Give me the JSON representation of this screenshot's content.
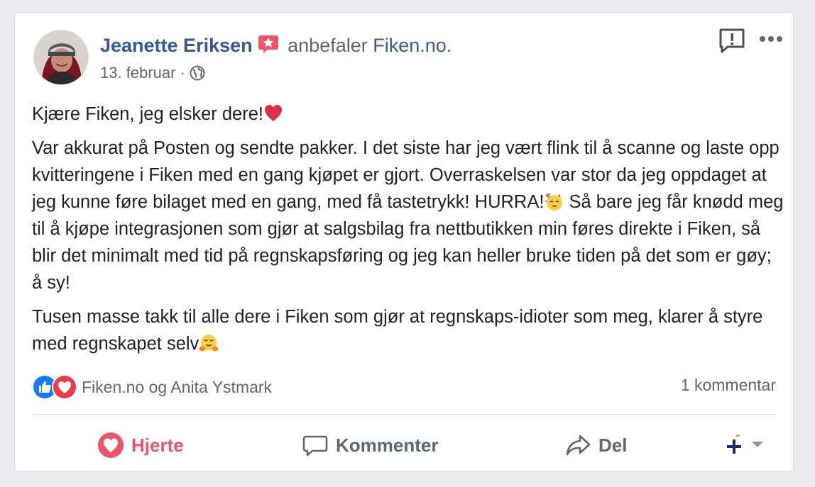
{
  "post": {
    "author": "Jeanette Eriksen",
    "action_text": "anbefaler",
    "page_name": "Fiken.no.",
    "date": "13. februar",
    "separator": "·",
    "paragraphs": [
      {
        "text": "Kjære Fiken, jeg elsker dere!",
        "emoji": "red-heart"
      },
      {
        "text_before_emoji": "Var akkurat på Posten og sendte pakker. I det siste har jeg vært flink til å scanne og laste opp kvitteringene i Fiken med en gang kjøpet er gjort. Overraskelsen var stor da jeg oppdaget at jeg kunne føre bilaget med en gang, med få tastetrykk! HURRA!",
        "emoji": "partying-face",
        "text_after_emoji": " Så bare jeg får knødd meg til å kjøpe integrasjonen som gjør at salgsbilag fra nettbutikken min føres direkte i Fiken, så blir det minimalt med tid på regnskapsføring og jeg kan heller bruke tiden på det som er gøy; å sy!"
      },
      {
        "text": "Tusen masse takk til alle dere i Fiken som gjør at regnskaps-idioter som meg, klarer å styre med regnskapet selv",
        "emoji": "hugging-face"
      }
    ]
  },
  "reactions": {
    "types": [
      "like",
      "love"
    ],
    "names": "Fiken.no og Anita Ystmark",
    "comments": "1 kommentar"
  },
  "actions": {
    "heart": "Hjerte",
    "comment": "Kommenter",
    "share": "Del"
  },
  "colors": {
    "link": "#385898",
    "meta": "#606770",
    "heart": "#e9566a",
    "like": "#1877f2",
    "badge": "#f35369"
  }
}
